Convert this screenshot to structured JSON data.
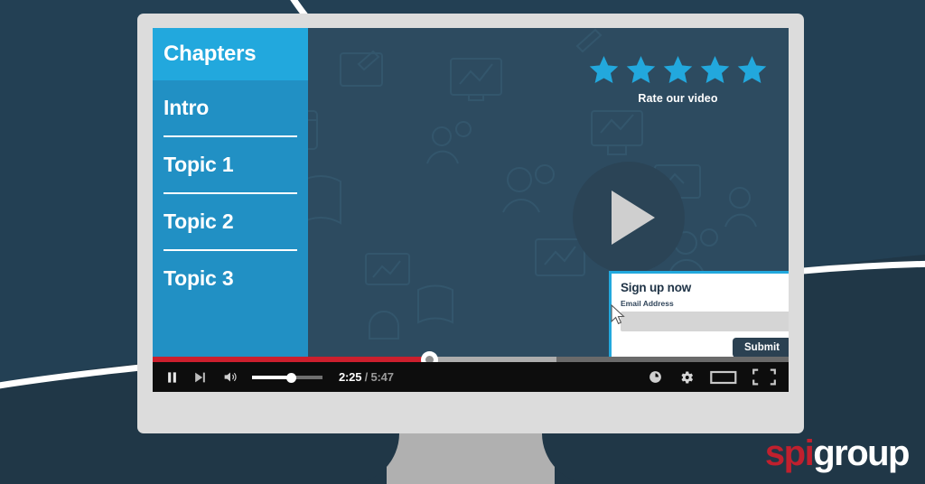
{
  "theme": {
    "page_bg": "#203747",
    "accent_blue": "#22a8dd",
    "sidebar_blue": "#2190c4",
    "screen_bg": "#2d4b60",
    "progress_red": "#cc1f2d",
    "logo_red": "#c0202e"
  },
  "sidebar": {
    "header": "Chapters",
    "items": [
      {
        "label": "Intro"
      },
      {
        "label": "Topic 1"
      },
      {
        "label": "Topic 2"
      },
      {
        "label": "Topic 3"
      }
    ]
  },
  "rating": {
    "label": "Rate our video",
    "stars": 5,
    "star_icon": "star-icon",
    "star_color": "#22a8dd"
  },
  "player": {
    "play_icon": "play-icon",
    "pause_icon": "pause-icon",
    "next_icon": "next-track-icon",
    "volume_icon": "volume-high-icon",
    "current_time": "2:25",
    "separator": "/",
    "total_time": "5:47",
    "progress_percent": 43.5,
    "volume_percent": 55,
    "watch_later_icon": "clock-icon",
    "settings_icon": "gear-icon",
    "theater_icon": "theater-mode-icon",
    "fullscreen_icon": "fullscreen-icon"
  },
  "signup": {
    "title": "Sign up now",
    "email_label": "Email Address",
    "email_value": "",
    "email_placeholder": "",
    "submit_label": "Submit",
    "cursor_icon": "mouse-pointer-icon"
  },
  "logo": {
    "part1": "spi",
    "part2": "group"
  }
}
